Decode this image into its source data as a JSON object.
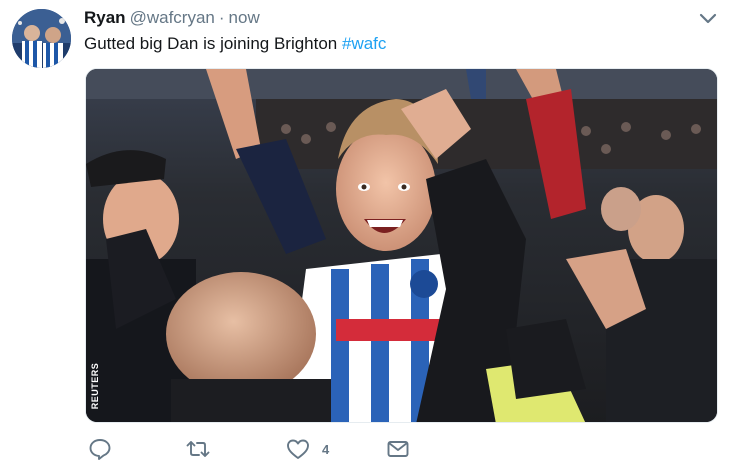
{
  "tweet": {
    "author_name": "Ryan",
    "author_handle": "@wafcryan",
    "separator": "·",
    "timestamp": "now",
    "text_body": "Gutted big Dan is joining Brighton ",
    "hashtag": "#wafc"
  },
  "media": {
    "watermark": "REUTERS"
  },
  "actions": {
    "reply_icon": "reply-icon",
    "retweet_icon": "retweet-icon",
    "like_icon": "heart-icon",
    "like_count": "4",
    "dm_icon": "envelope-icon"
  },
  "colors": {
    "accent": "#1da1f2",
    "muted": "#657786",
    "text": "#14171a"
  }
}
